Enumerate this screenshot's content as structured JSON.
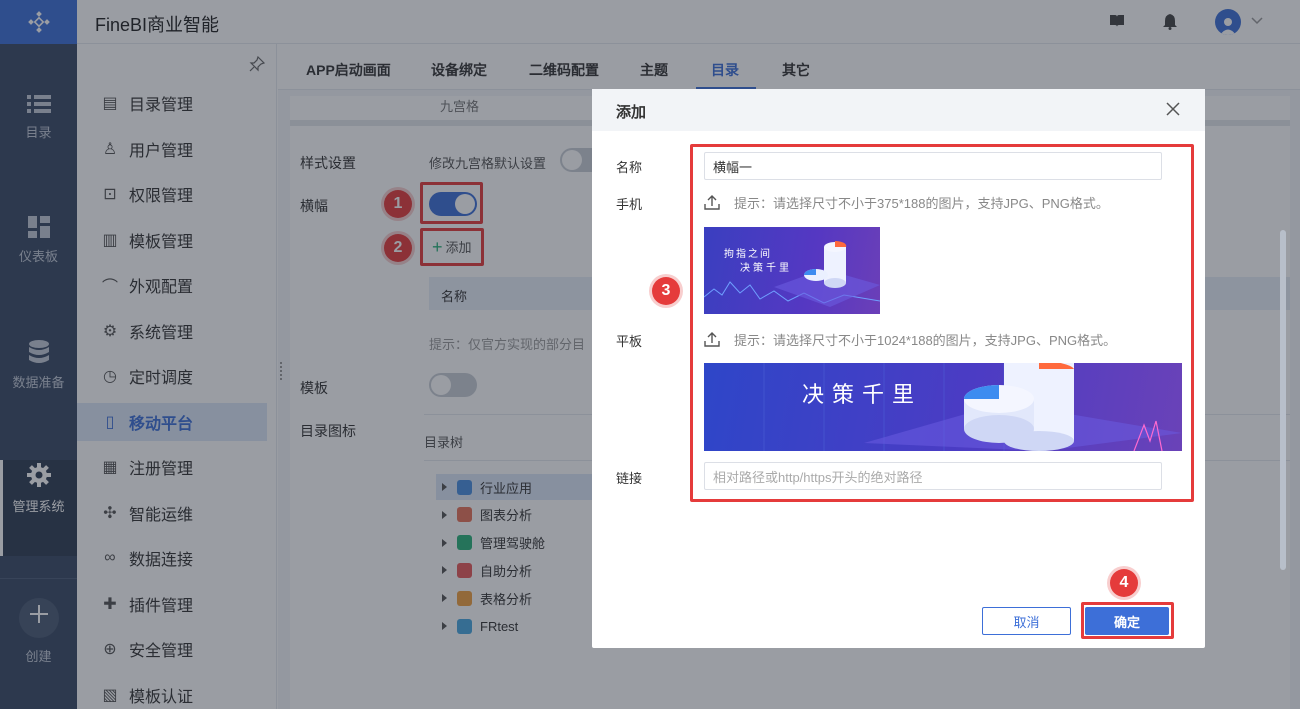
{
  "app": {
    "title": "FineBI商业智能"
  },
  "rail": {
    "items": [
      {
        "label": "目录",
        "icon": "list-icon"
      },
      {
        "label": "仪表板",
        "icon": "dashboard-icon"
      },
      {
        "label": "数据准备",
        "icon": "database-icon"
      },
      {
        "label": "管理系统",
        "icon": "gear-icon"
      },
      {
        "label": "创建",
        "icon": "plus-icon"
      }
    ],
    "active": "管理系统"
  },
  "menu": {
    "items": [
      {
        "label": "目录管理",
        "icon": "catalog-icon"
      },
      {
        "label": "用户管理",
        "icon": "user-icon"
      },
      {
        "label": "权限管理",
        "icon": "lock-icon"
      },
      {
        "label": "模板管理",
        "icon": "template-icon"
      },
      {
        "label": "外观配置",
        "icon": "brush-icon"
      },
      {
        "label": "系统管理",
        "icon": "settings-icon"
      },
      {
        "label": "定时调度",
        "icon": "timer-icon"
      },
      {
        "label": "移动平台",
        "icon": "mobile-icon"
      },
      {
        "label": "注册管理",
        "icon": "register-icon"
      },
      {
        "label": "智能运维",
        "icon": "ops-icon"
      },
      {
        "label": "数据连接",
        "icon": "link-icon"
      },
      {
        "label": "插件管理",
        "icon": "puzzle-icon"
      },
      {
        "label": "安全管理",
        "icon": "shield-icon"
      },
      {
        "label": "模板认证",
        "icon": "certify-icon"
      }
    ],
    "active": "移动平台"
  },
  "tabs": {
    "items": [
      "APP启动画面",
      "设备绑定",
      "二维码配置",
      "主题",
      "目录",
      "其它"
    ],
    "active": "目录"
  },
  "settings": {
    "top_cut_text": "九宫格",
    "style_label": "样式设置",
    "style_hint": "修改九宫格默认设置",
    "banner_label": "横幅",
    "banner_toggle": true,
    "add_label": "添加",
    "name_header": "名称",
    "hint_text": "提示：仅官方实现的部分目",
    "template_label": "模板",
    "template_toggle": false,
    "catalog_icon_label": "目录图标",
    "catalog_tree_label": "目录树",
    "tree": [
      {
        "label": "行业应用",
        "color": "#4a8fe0",
        "selected": true
      },
      {
        "label": "图表分析",
        "color": "#e8735a",
        "selected": false
      },
      {
        "label": "管理驾驶舱",
        "color": "#2ab27b",
        "selected": false
      },
      {
        "label": "自助分析",
        "color": "#e85a5a",
        "selected": false
      },
      {
        "label": "表格分析",
        "color": "#f0a040",
        "selected": false
      },
      {
        "label": "FRtest",
        "color": "#4aa8e0",
        "selected": false
      }
    ]
  },
  "modal": {
    "title": "添加",
    "name_label": "名称",
    "name_value": "横幅一",
    "phone_label": "手机",
    "phone_hint": "提示：请选择尺寸不小于375*188的图片，支持JPG、PNG格式。",
    "phone_banner_line1": "拘指之间",
    "phone_banner_line2": "决策千里",
    "tablet_label": "平板",
    "tablet_hint": "提示：请选择尺寸不小于1024*188的图片，支持JPG、PNG格式。",
    "tablet_banner_text": "决策千里",
    "link_label": "链接",
    "link_placeholder": "相对路径或http/https开头的绝对路径",
    "cancel_label": "取消",
    "ok_label": "确定"
  },
  "callouts": [
    "1",
    "2",
    "3",
    "4"
  ],
  "colors": {
    "brand": "#3d6fd8",
    "rail": "#3a4a64",
    "callout": "#e53b3b"
  }
}
